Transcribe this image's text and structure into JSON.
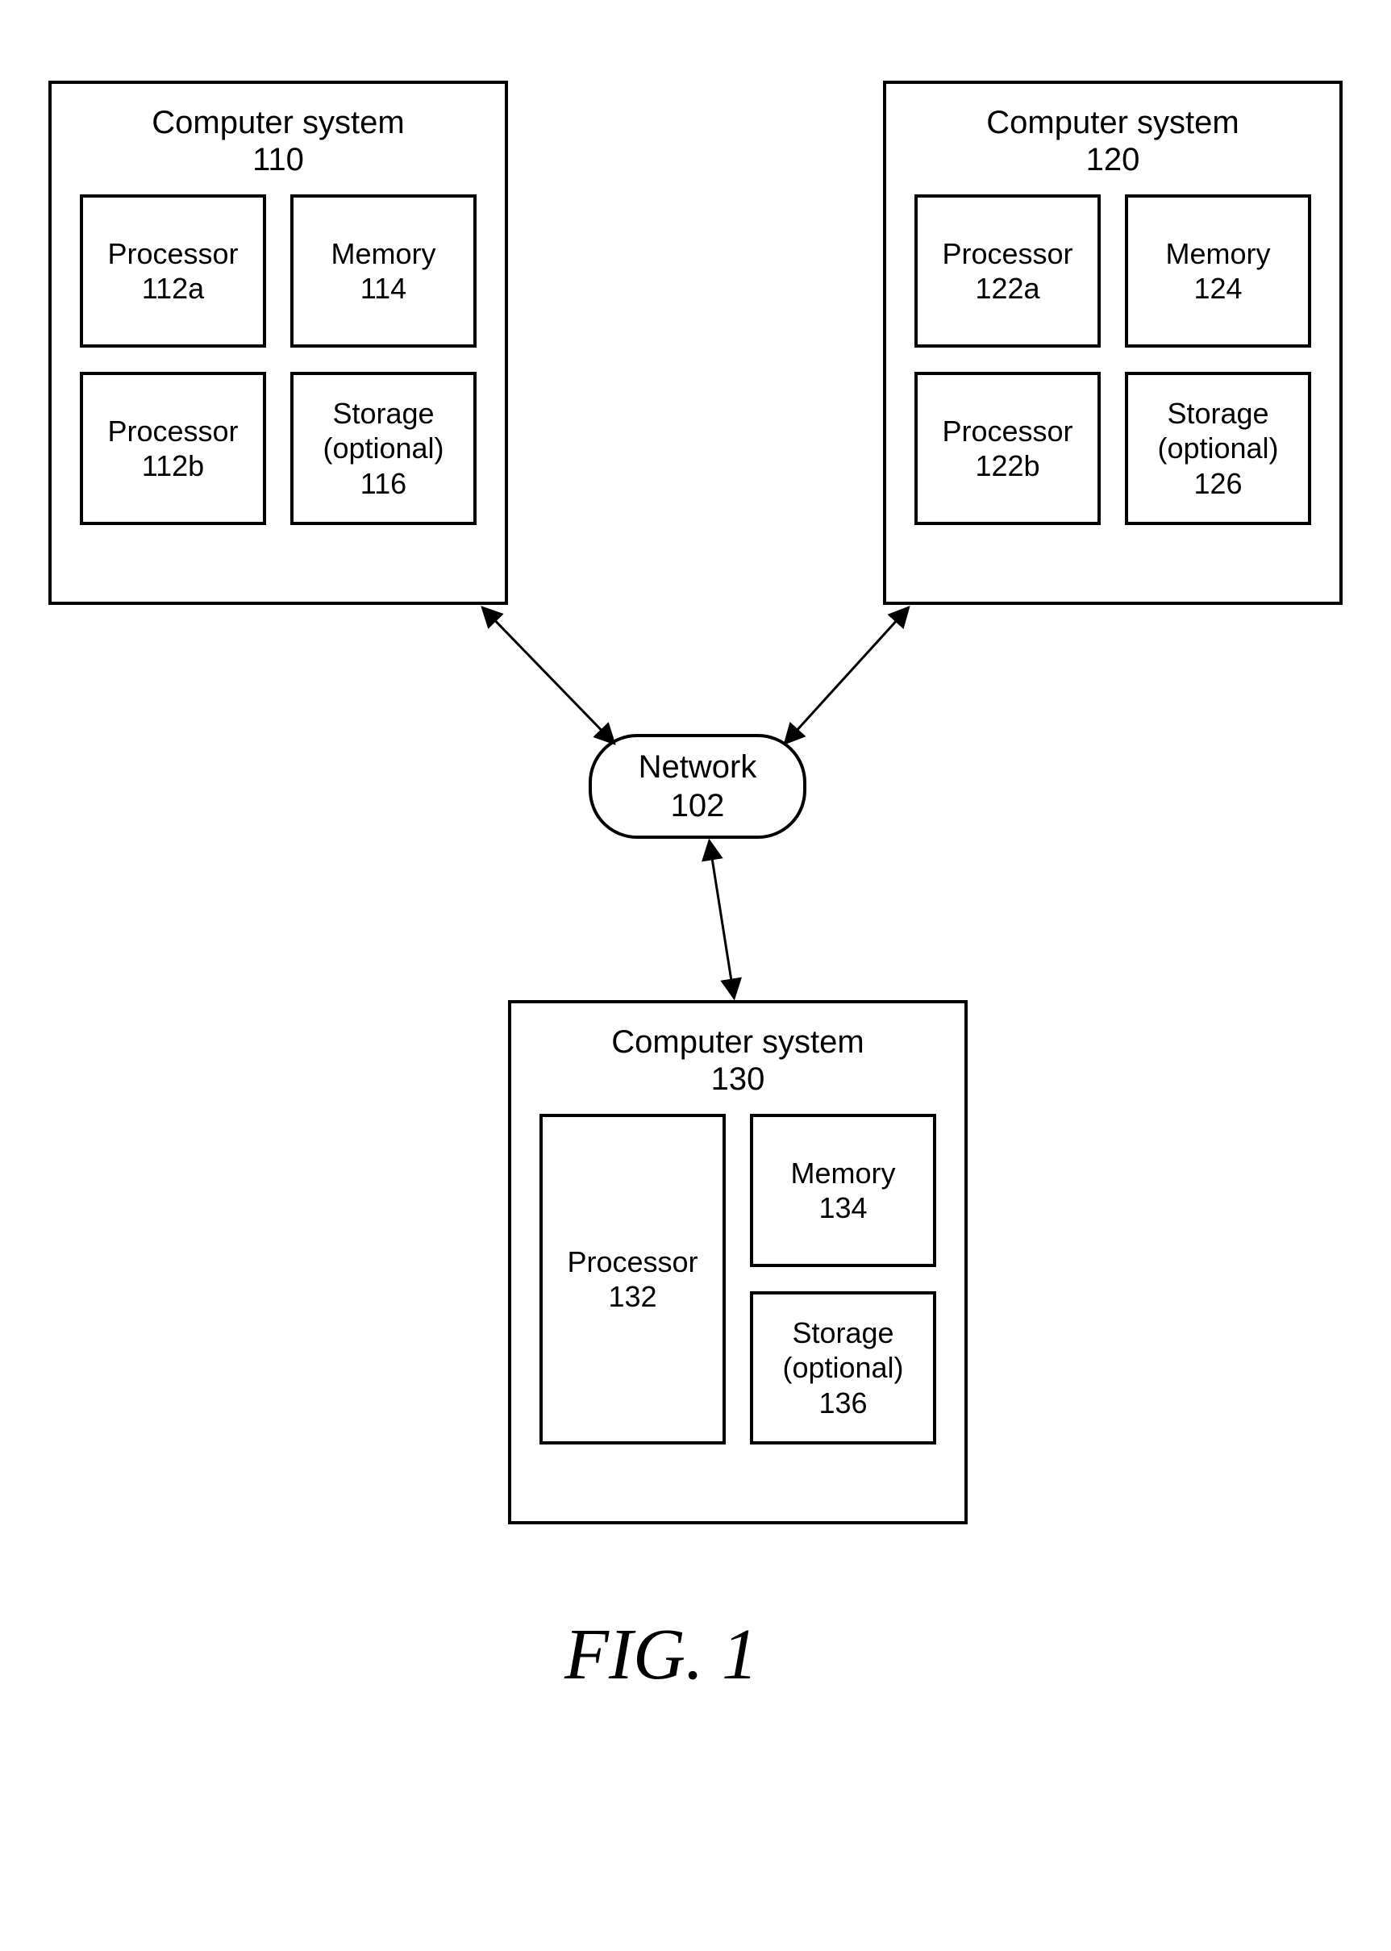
{
  "figure_label": "FIG. 1",
  "network": {
    "label": "Network\n102"
  },
  "systems": {
    "s110": {
      "title": "Computer system\n110",
      "c1": "Processor\n112a",
      "c2": "Memory\n114",
      "c3": "Processor\n112b",
      "c4": "Storage\n(optional)\n116"
    },
    "s120": {
      "title": "Computer system\n120",
      "c1": "Processor\n122a",
      "c2": "Memory\n124",
      "c3": "Processor\n122b",
      "c4": "Storage\n(optional)\n126"
    },
    "s130": {
      "title": "Computer system\n130",
      "c1": "Processor\n132",
      "c2": "Memory\n134",
      "c3": "Storage\n(optional)\n136"
    }
  }
}
